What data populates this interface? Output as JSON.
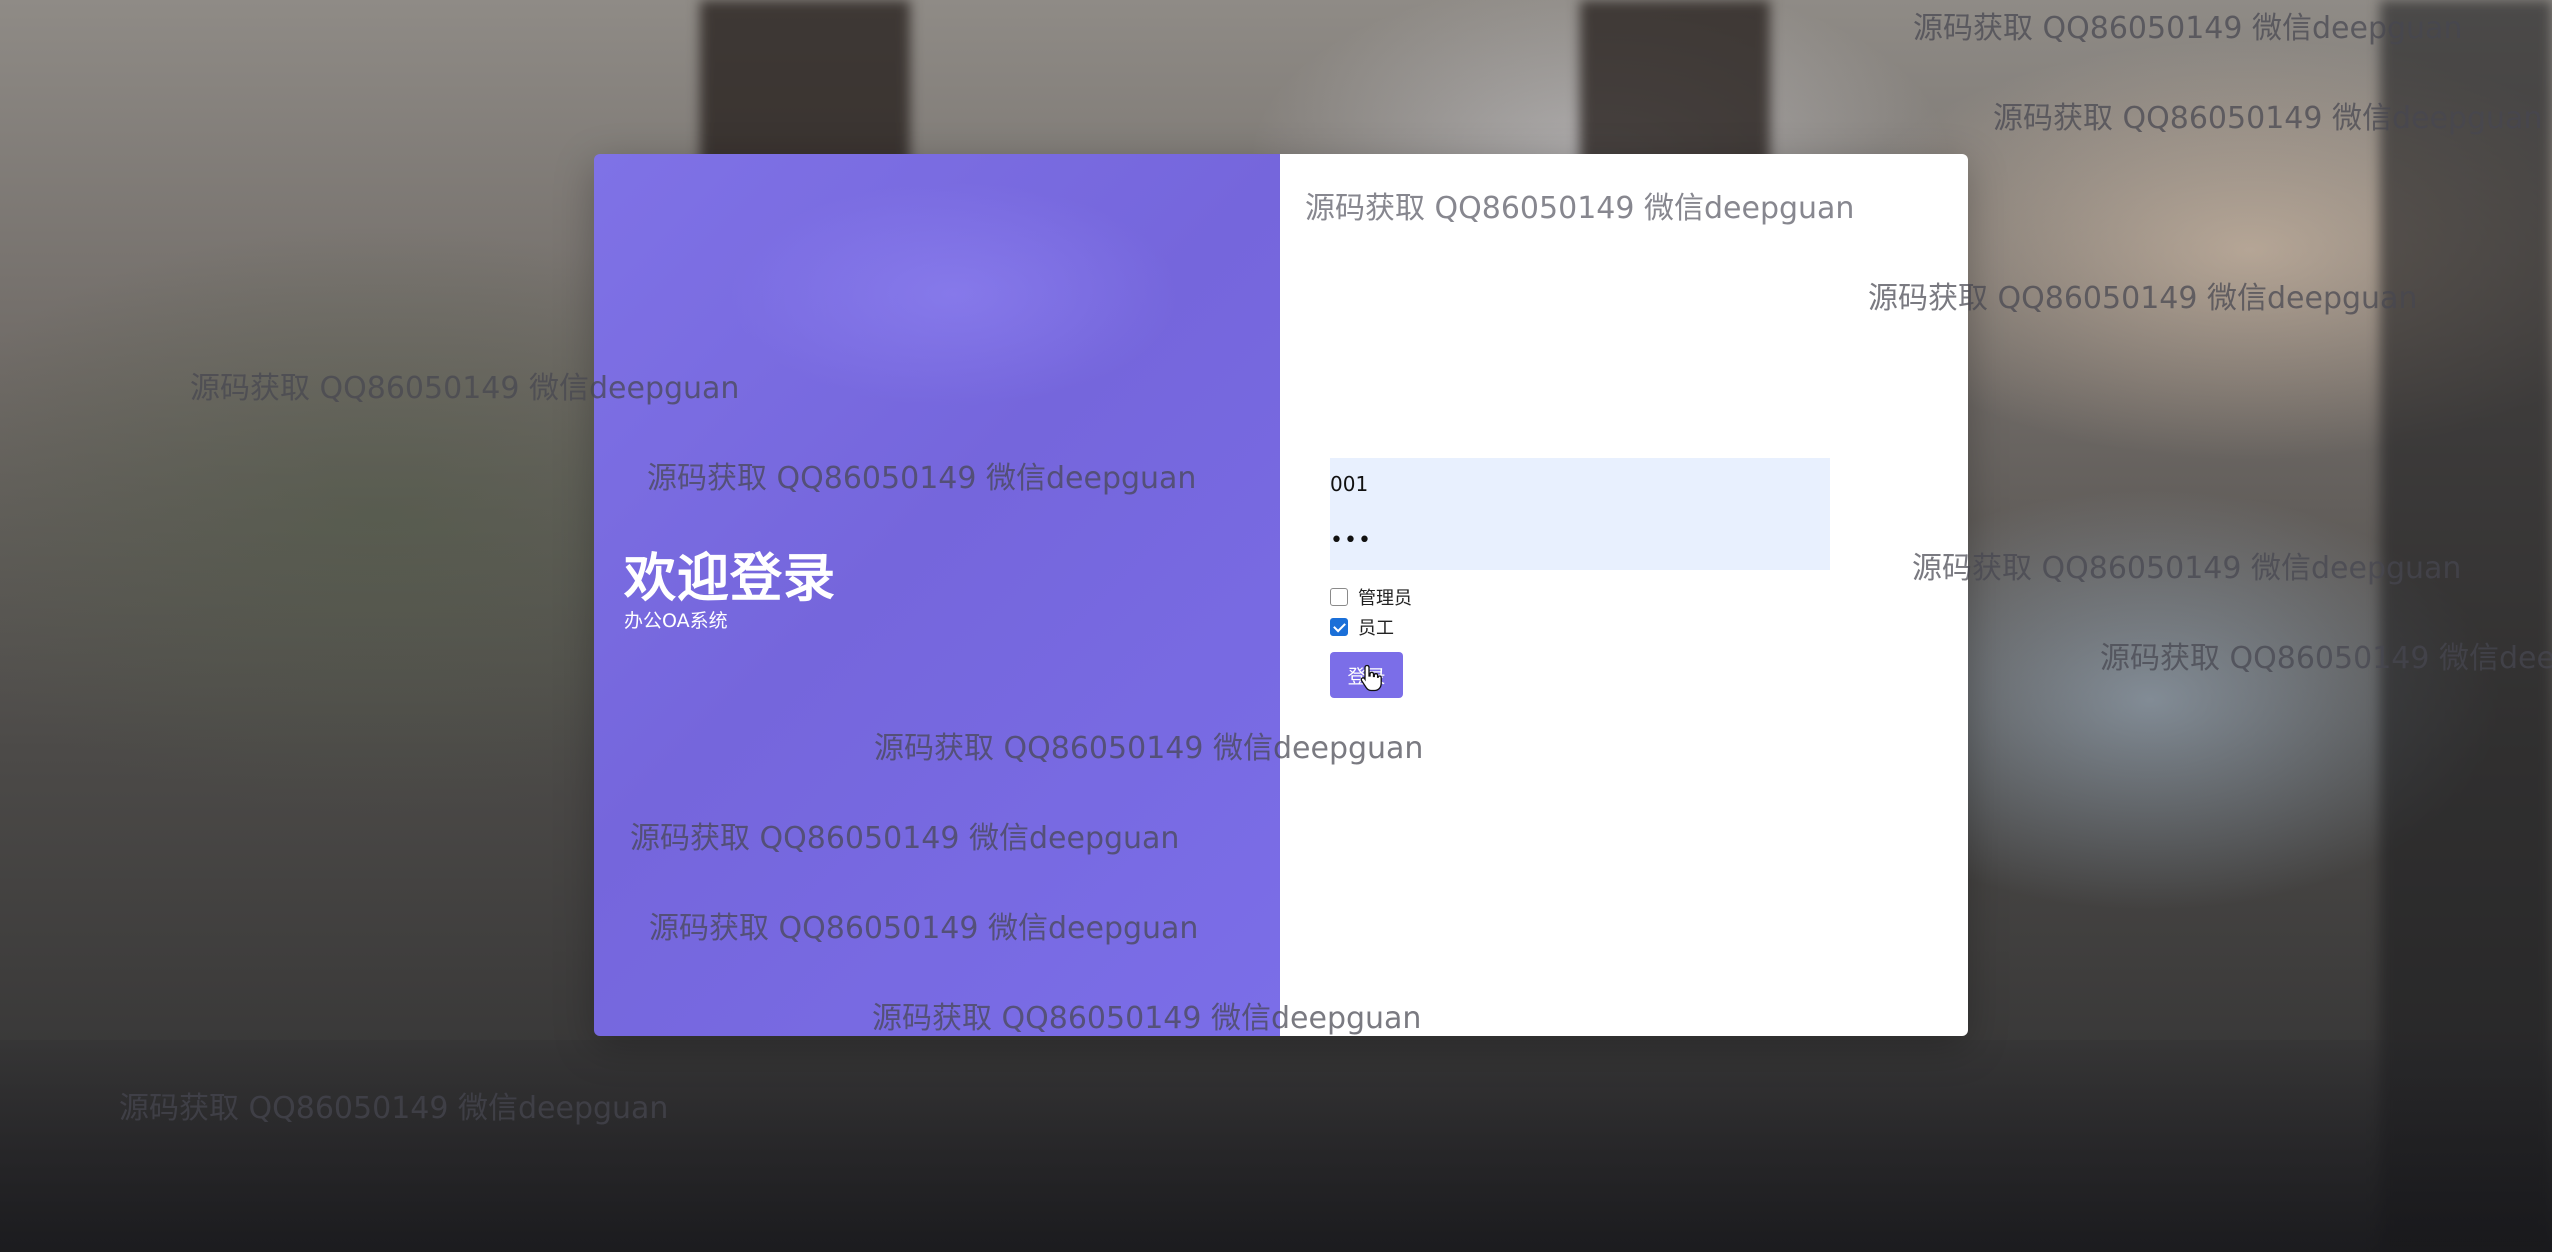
{
  "welcome": {
    "title": "欢迎登录",
    "subtitle": "办公OA系统"
  },
  "form": {
    "username_value": "001",
    "password_value": "•••",
    "roles": [
      {
        "label": "管理员",
        "checked": false
      },
      {
        "label": "员工",
        "checked": true
      }
    ],
    "login_label": "登录"
  },
  "watermark_text": "源码获取 QQ86050149 微信deepguan",
  "colors": {
    "panel_purple": "#7b6ee8",
    "input_bg": "#e8f0fe",
    "checkbox_blue": "#1a6fd8"
  }
}
